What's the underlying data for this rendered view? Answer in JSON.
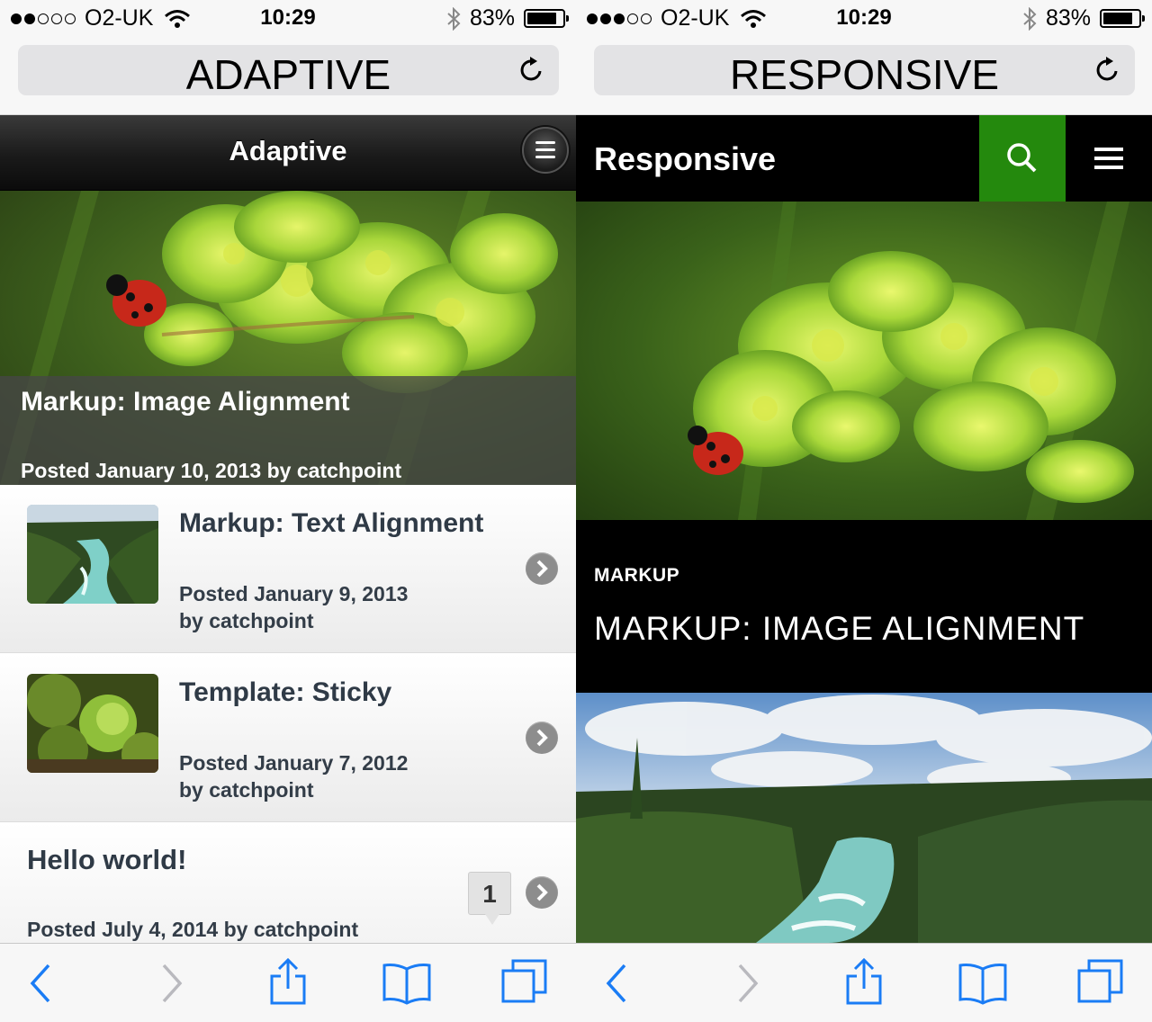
{
  "status_bar": {
    "carrier": "O2-UK",
    "time": "10:29",
    "battery_pct": "83%",
    "battery_level": 0.83
  },
  "adaptive": {
    "url_title": "ADAPTIVE",
    "site_title": "Adaptive",
    "featured": {
      "title": "Markup: Image Alignment",
      "meta": "Posted January 10, 2013 by catchpoint"
    },
    "posts": [
      {
        "title": "Markup: Text Alignment",
        "date": "Posted January 9, 2013",
        "author": "by catchpoint"
      },
      {
        "title": "Template: Sticky",
        "date": "Posted January 7, 2012",
        "author": "by catchpoint"
      }
    ],
    "hello": {
      "title": "Hello world!",
      "meta": "Posted July 4, 2014  by catchpoint",
      "comments": "1"
    }
  },
  "responsive": {
    "url_title": "RESPONSIVE",
    "site_title": "Responsive",
    "category": "MARKUP",
    "entry_title": "MARKUP: IMAGE ALIGNMENT",
    "accent": "#24890d"
  },
  "icons": {
    "toolbar": [
      "back-icon",
      "forward-icon",
      "share-icon",
      "bookmarks-icon",
      "tabs-icon"
    ],
    "tint": "#1a7cf5"
  }
}
